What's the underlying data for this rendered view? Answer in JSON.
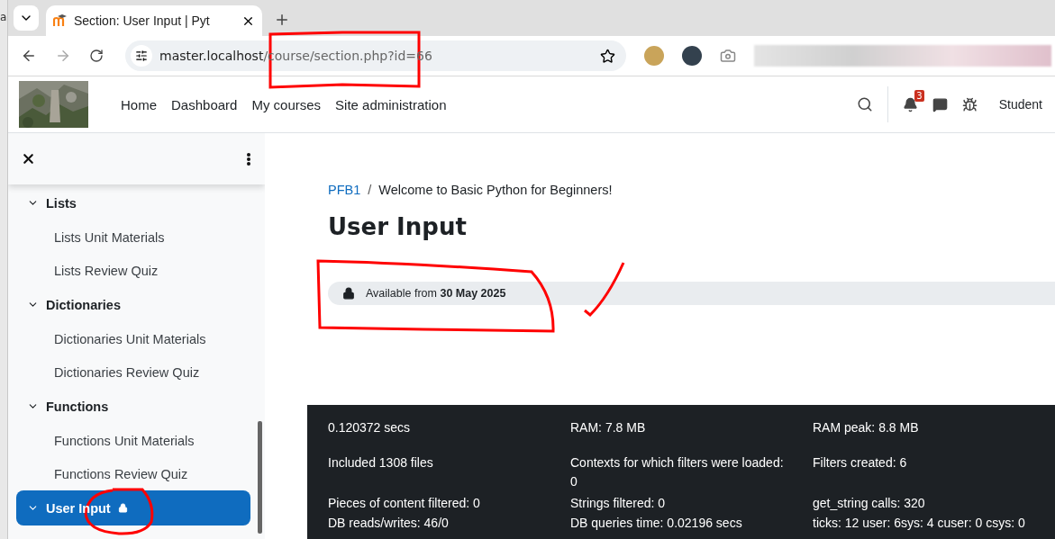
{
  "browser": {
    "partial_tab": "a",
    "tab": {
      "title": "Section: User Input | Pyt",
      "selected": true
    },
    "url": {
      "host": "master.localhost",
      "path": "/course/section.php?id=66"
    }
  },
  "navbar": {
    "links": [
      "Home",
      "Dashboard",
      "My courses",
      "Site administration"
    ],
    "notification_count": "3",
    "user": "Student"
  },
  "sidebar": {
    "items": [
      {
        "label": "Lists",
        "expanded": true,
        "selected": false,
        "locked": false,
        "children": [
          {
            "label": "Lists Unit Materials"
          },
          {
            "label": "Lists Review Quiz"
          }
        ]
      },
      {
        "label": "Dictionaries",
        "expanded": true,
        "selected": false,
        "locked": false,
        "children": [
          {
            "label": "Dictionaries Unit Materials"
          },
          {
            "label": "Dictionaries Review Quiz"
          }
        ]
      },
      {
        "label": "Functions",
        "expanded": true,
        "selected": false,
        "locked": false,
        "children": [
          {
            "label": "Functions Unit Materials"
          },
          {
            "label": "Functions Review Quiz"
          }
        ]
      },
      {
        "label": "User Input",
        "expanded": true,
        "selected": true,
        "locked": true
      }
    ]
  },
  "main": {
    "separator": "/",
    "breadcrumb": [
      {
        "label": "PFB1",
        "link": true
      },
      {
        "label": "Welcome to Basic Python for Beginners!",
        "link": false
      }
    ],
    "title": "User Input",
    "availability": "Available from **30 May 2025**"
  },
  "footer": {
    "stats": [
      "0.120372 secs",
      "RAM: 7.8 MB",
      "RAM peak: 8.8 MB",
      "Included 1308 files",
      "Contexts for which filters were loaded: 0",
      "Filters created: 6",
      "Pieces of content filtered: 0",
      "Strings filtered: 0",
      "get_string calls: 320",
      "DB reads/writes: 46/0",
      "DB queries time: 0.02196 secs",
      "ticks: 12 user: 6sys: 4 cuser: 0 csys: 0"
    ]
  }
}
